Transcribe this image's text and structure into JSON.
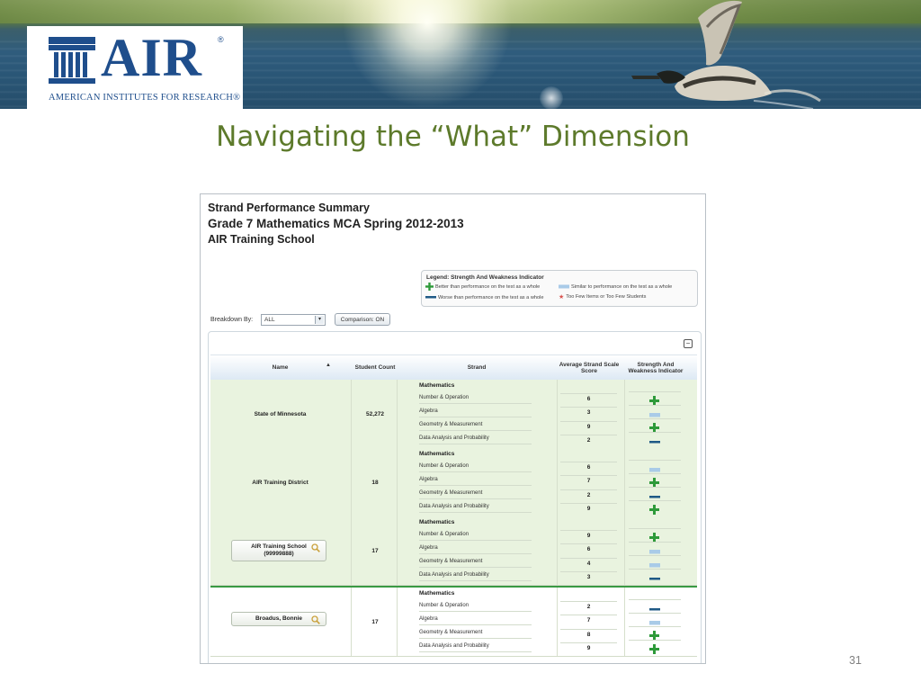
{
  "logo": {
    "word": "AIR",
    "registered": "®",
    "tagline": "AMERICAN INSTITUTES FOR RESEARCH®"
  },
  "slide": {
    "title": "Navigating the “What” Dimension",
    "page_number": "31"
  },
  "report": {
    "heading1": "Strand Performance Summary",
    "heading2": "Grade 7 Mathematics MCA Spring 2012-2013",
    "heading3": "AIR Training School",
    "legend": {
      "title": "Legend: Strength And Weakness Indicator",
      "better": "Better than performance on the test as a whole",
      "similar": "Similar to performance on the test as a whole",
      "worse": "Worse than performance on the test as a whole",
      "too_few": "Too Few Items or Too Few Students"
    },
    "breakdown": {
      "label": "Breakdown By:",
      "value": "ALL"
    },
    "comparison_button": "Comparison: ON",
    "columns": {
      "name": "Name",
      "student_count": "Student Count",
      "strand": "Strand",
      "avg_score": "Average Strand Scale Score",
      "indicator": "Strength And Weakness Indicator"
    },
    "groups": [
      {
        "name": "State of Minnesota",
        "sub": "",
        "count": "52,272",
        "style": "green",
        "button": false,
        "subject": "Mathematics",
        "strands": [
          {
            "name": "Number & Operation",
            "score": "6",
            "indicator": "better"
          },
          {
            "name": "Algebra",
            "score": "3",
            "indicator": "similar"
          },
          {
            "name": "Geometry & Measurement",
            "score": "9",
            "indicator": "better"
          },
          {
            "name": "Data Analysis and Probability",
            "score": "2",
            "indicator": "worse"
          }
        ]
      },
      {
        "name": "AIR Training District",
        "sub": "",
        "count": "18",
        "style": "green",
        "button": false,
        "subject": "Mathematics",
        "strands": [
          {
            "name": "Number & Operation",
            "score": "6",
            "indicator": "similar"
          },
          {
            "name": "Algebra",
            "score": "7",
            "indicator": "better"
          },
          {
            "name": "Geometry & Measurement",
            "score": "2",
            "indicator": "worse"
          },
          {
            "name": "Data Analysis and Probability",
            "score": "9",
            "indicator": "better"
          }
        ]
      },
      {
        "name": "AIR Training School",
        "sub": "(99999888)",
        "count": "17",
        "style": "green",
        "button": true,
        "subject": "Mathematics",
        "strands": [
          {
            "name": "Number & Operation",
            "score": "9",
            "indicator": "better"
          },
          {
            "name": "Algebra",
            "score": "6",
            "indicator": "similar"
          },
          {
            "name": "Geometry & Measurement",
            "score": "4",
            "indicator": "similar"
          },
          {
            "name": "Data Analysis and Probability",
            "score": "3",
            "indicator": "worse"
          }
        ]
      },
      {
        "name": "Broadus, Bonnie",
        "sub": "",
        "count": "17",
        "style": "white",
        "button": true,
        "subject": "Mathematics",
        "strands": [
          {
            "name": "Number & Operation",
            "score": "2",
            "indicator": "worse"
          },
          {
            "name": "Algebra",
            "score": "7",
            "indicator": "similar"
          },
          {
            "name": "Geometry & Measurement",
            "score": "8",
            "indicator": "better"
          },
          {
            "name": "Data Analysis and Probability",
            "score": "9",
            "indicator": "better"
          }
        ]
      }
    ]
  },
  "colors": {
    "title_green": "#5d7a2b",
    "logo_blue": "#1f4e8c",
    "better_green": "#2e9a3a",
    "similar_blue": "#a9cbe8",
    "worse_navy": "#1f5a86",
    "too_few_red": "#d9534f"
  },
  "icons": {
    "better": "green-plus-icon",
    "similar": "light-blue-bar-icon",
    "worse": "navy-dash-icon",
    "too_few": "red-star-icon",
    "details": "magnifier-icon",
    "collapse": "collapse-icon",
    "sort": "sort-arrow-icon",
    "dropdown": "dropdown-arrow-icon"
  }
}
